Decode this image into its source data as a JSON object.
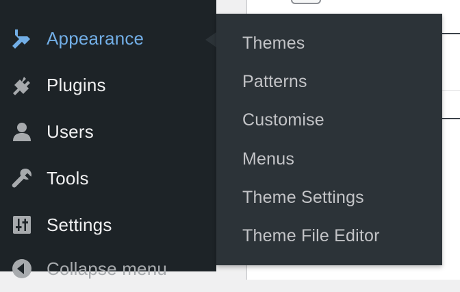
{
  "sidebar": {
    "items": [
      {
        "label": "Appearance",
        "icon": "paintbrush-icon",
        "current": true
      },
      {
        "label": "Plugins",
        "icon": "plug-icon"
      },
      {
        "label": "Users",
        "icon": "user-icon"
      },
      {
        "label": "Tools",
        "icon": "wrench-icon"
      },
      {
        "label": "Settings",
        "icon": "sliders-icon"
      },
      {
        "label": "Collapse menu",
        "icon": "collapse-arrow-icon"
      }
    ]
  },
  "flyout": {
    "items": [
      {
        "label": "Themes"
      },
      {
        "label": "Patterns"
      },
      {
        "label": "Customise"
      },
      {
        "label": "Menus"
      },
      {
        "label": "Theme Settings"
      },
      {
        "label": "Theme File Editor"
      }
    ]
  },
  "colors": {
    "sidebar_bg": "#1d2327",
    "flyout_bg": "#2c3338",
    "accent": "#72aee6",
    "current_bar": "#2271b1",
    "text": "#f0f0f1",
    "submenu_text": "#c3c4c7"
  }
}
